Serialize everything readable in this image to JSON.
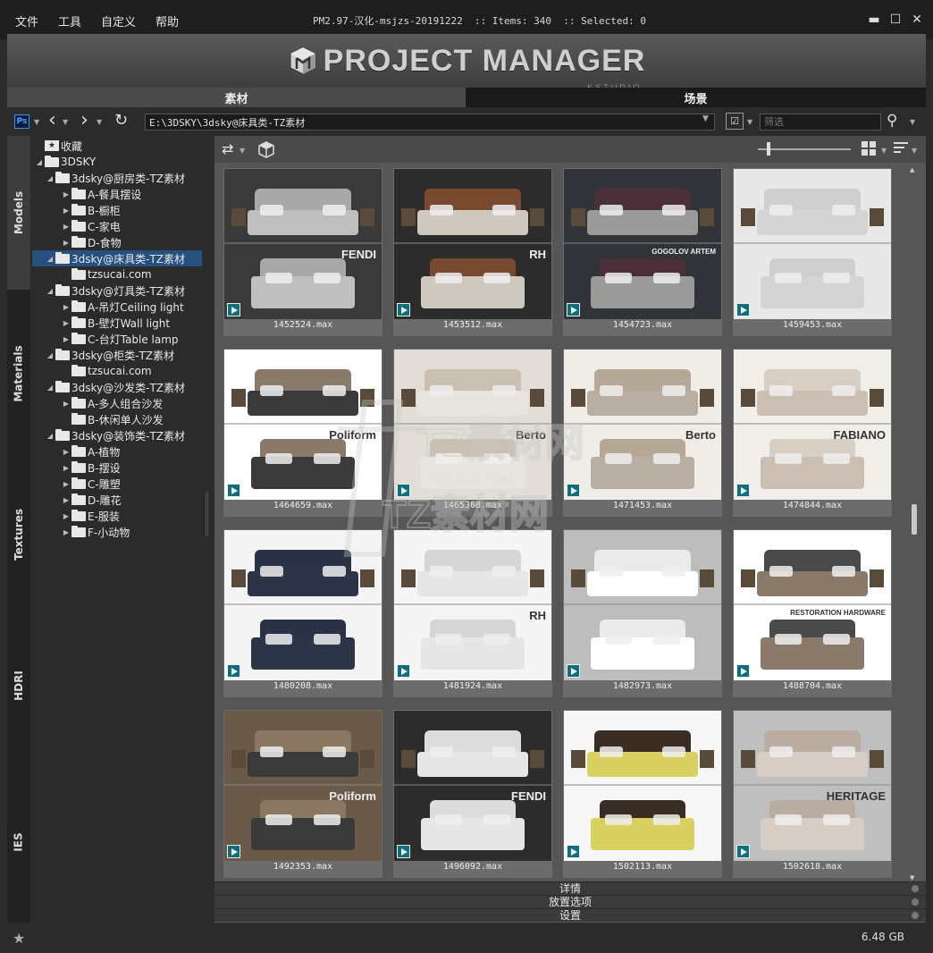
{
  "menu": [
    "文件",
    "工具",
    "自定义",
    "帮助"
  ],
  "window_title": "PM2.97-汉化-msjzs-20191222  :: Items: 340  :: Selected: 0",
  "window_controls": {
    "close": "✕",
    "minimize": "▬",
    "maximize": "☐"
  },
  "banner": {
    "title": "PROJECT MANAGER",
    "subtitle": "KSTUDIO"
  },
  "tabs": [
    "素材",
    "场景"
  ],
  "toolbar": {
    "ps_label": "Ps",
    "path": "E:\\3DSKY\\3dsky@床具类-TZ素材",
    "filter_placeholder": "筛选"
  },
  "side_tabs": [
    "Models",
    "Materials",
    "Textures",
    "HDRI",
    "IES"
  ],
  "tree": [
    {
      "label": "收藏",
      "level": 0,
      "expanded": null,
      "icon": "star-folder"
    },
    {
      "label": "3DSKY",
      "level": 0,
      "expanded": true,
      "icon": "folder"
    },
    {
      "label": "3dsky@厨房类-TZ素材",
      "level": 1,
      "expanded": true,
      "icon": "folder"
    },
    {
      "label": "A-餐具摆设",
      "level": 2,
      "expanded": false,
      "icon": "folder"
    },
    {
      "label": "B-橱柜",
      "level": 2,
      "expanded": false,
      "icon": "folder"
    },
    {
      "label": "C-家电",
      "level": 2,
      "expanded": false,
      "icon": "folder"
    },
    {
      "label": "D-食物",
      "level": 2,
      "expanded": false,
      "icon": "folder"
    },
    {
      "label": "3dsky@床具类-TZ素材",
      "level": 1,
      "expanded": true,
      "icon": "folder",
      "selected": true
    },
    {
      "label": "tzsucai.com",
      "level": 2,
      "expanded": null,
      "icon": "folder"
    },
    {
      "label": "3dsky@灯具类-TZ素材",
      "level": 1,
      "expanded": true,
      "icon": "folder"
    },
    {
      "label": "A-吊灯Ceiling light",
      "level": 2,
      "expanded": false,
      "icon": "folder"
    },
    {
      "label": "B-壁灯Wall light",
      "level": 2,
      "expanded": false,
      "icon": "folder"
    },
    {
      "label": "C-台灯Table lamp",
      "level": 2,
      "expanded": false,
      "icon": "folder"
    },
    {
      "label": "3dsky@柜类-TZ素材",
      "level": 1,
      "expanded": true,
      "icon": "folder"
    },
    {
      "label": "tzsucai.com",
      "level": 2,
      "expanded": null,
      "icon": "folder"
    },
    {
      "label": "3dsky@沙发类-TZ素材",
      "level": 1,
      "expanded": true,
      "icon": "folder"
    },
    {
      "label": "A-多人组合沙发",
      "level": 2,
      "expanded": false,
      "icon": "folder"
    },
    {
      "label": "B-休闲单人沙发",
      "level": 2,
      "expanded": null,
      "icon": "folder"
    },
    {
      "label": "3dsky@装饰类-TZ素材",
      "level": 1,
      "expanded": true,
      "icon": "folder"
    },
    {
      "label": "A-植物",
      "level": 2,
      "expanded": false,
      "icon": "folder"
    },
    {
      "label": "B-摆设",
      "level": 2,
      "expanded": false,
      "icon": "folder"
    },
    {
      "label": "C-雕塑",
      "level": 2,
      "expanded": false,
      "icon": "folder"
    },
    {
      "label": "D-雕花",
      "level": 2,
      "expanded": false,
      "icon": "folder"
    },
    {
      "label": "E-服装",
      "level": 2,
      "expanded": false,
      "icon": "folder"
    },
    {
      "label": "F-小动物",
      "level": 2,
      "expanded": false,
      "icon": "folder"
    }
  ],
  "thumbnails": [
    {
      "file": "1452524.max",
      "brand": "FENDI",
      "bg": "#3a3a3a",
      "bed": "#bfbfbf",
      "head": "#a8a8a8"
    },
    {
      "file": "1453512.max",
      "brand": "RH",
      "bg": "#2c2c2c",
      "bed": "#cfc8bf",
      "head": "#7a4a30"
    },
    {
      "file": "1454723.max",
      "brand": "GOGOLOV ARTEM",
      "bg": "#303438",
      "bed": "#9a9a9a",
      "head": "#4a2e38"
    },
    {
      "file": "1459453.max",
      "brand": "",
      "bg": "#e8e8e8",
      "bed": "#d4d4d4",
      "head": "#cfcfcf"
    },
    {
      "file": "1464659.max",
      "brand": "Poliform",
      "bg": "#ffffff",
      "bed": "#3a3a3a",
      "head": "#8a7a6a"
    },
    {
      "file": "1465368.max",
      "brand": "Berto",
      "bg": "#e2ddd6",
      "bed": "#e8e4de",
      "head": "#c9bfb2"
    },
    {
      "file": "1471453.max",
      "brand": "Berto",
      "bg": "#f0ede8",
      "bed": "#b8aea2",
      "head": "#b5a896"
    },
    {
      "file": "1474844.max",
      "brand": "FABIANO",
      "bg": "#f2efea",
      "bed": "#cbbfb3",
      "head": "#d8cfc4"
    },
    {
      "file": "1480208.max",
      "brand": "",
      "bg": "#f4f4f4",
      "bed": "#2c3448",
      "head": "#2a3246"
    },
    {
      "file": "1481924.max",
      "brand": "RH",
      "bg": "#f5f5f5",
      "bed": "#e6e6e6",
      "head": "#d6d6d6"
    },
    {
      "file": "1482973.max",
      "brand": "",
      "bg": "#bdbdbd",
      "bed": "#ffffff",
      "head": "#eaeaea"
    },
    {
      "file": "1488704.max",
      "brand": "RESTORATION HARDWARE",
      "bg": "#ffffff",
      "bed": "#8a7a6a",
      "head": "#4a4a4a"
    },
    {
      "file": "1492353.max",
      "brand": "Poliform",
      "bg": "#6a5a48",
      "bed": "#3a3a3a",
      "head": "#8a7862"
    },
    {
      "file": "1496092.max",
      "brand": "FENDI",
      "bg": "#2c2c2c",
      "bed": "#e6e6e6",
      "head": "#dcdcdc"
    },
    {
      "file": "1502113.max",
      "brand": "",
      "bg": "#f7f7f7",
      "bed": "#d8d060",
      "head": "#3a2e24"
    },
    {
      "file": "1502618.max",
      "brand": "HERITAGE",
      "bg": "#bfbfbf",
      "bed": "#d6cec4",
      "head": "#b8ada0"
    }
  ],
  "accordion": [
    "详情",
    "放置选项",
    "设置"
  ],
  "status": {
    "size": "6.48 GB",
    "star": "★"
  },
  "watermark": {
    "text": "TZ素材网",
    "subtext": "TZSUCAI.COM"
  }
}
